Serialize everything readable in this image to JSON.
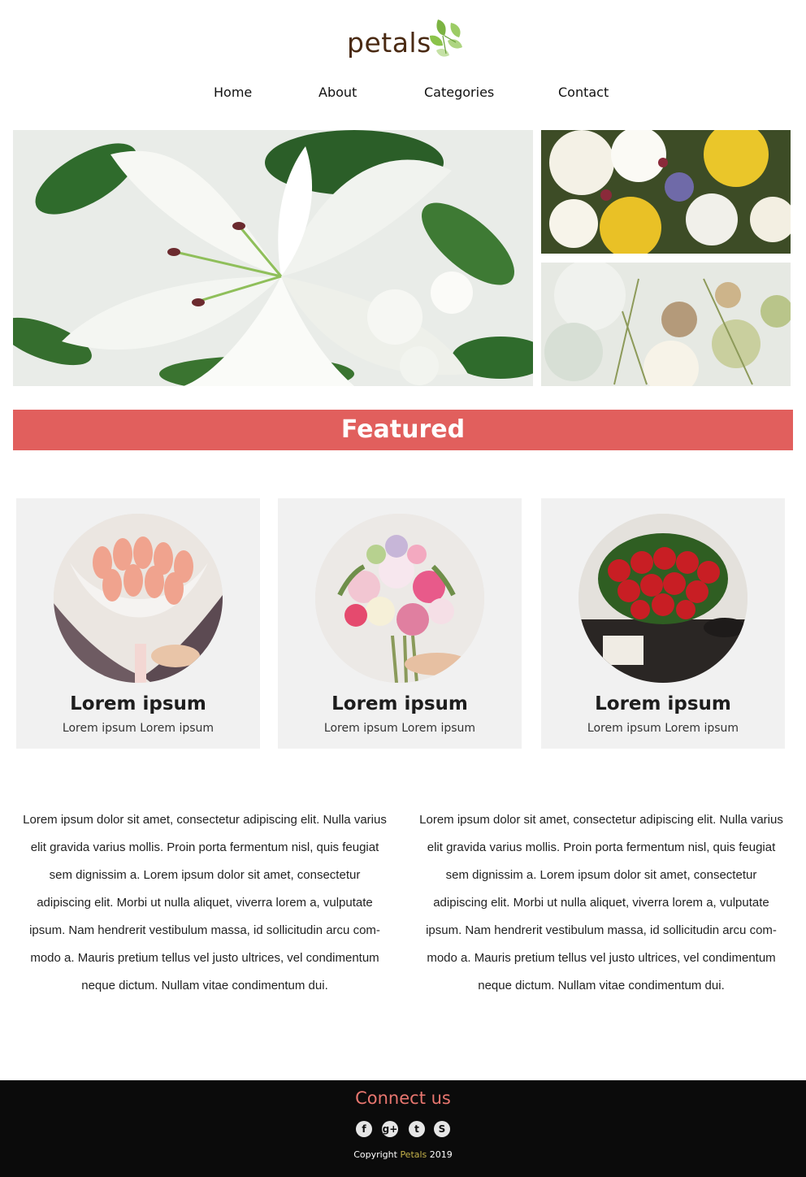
{
  "brand": {
    "logo_text": "petals"
  },
  "nav": {
    "items": [
      {
        "label": "Home"
      },
      {
        "label": "About"
      },
      {
        "label": "Categories"
      },
      {
        "label": "Contact"
      }
    ]
  },
  "featured": {
    "title": "Featured",
    "cards": [
      {
        "title": "Lorem ipsum",
        "subtitle": "Lorem ipsum Lorem ipsum"
      },
      {
        "title": "Lorem ipsum",
        "subtitle": "Lorem ipsum Lorem ipsum"
      },
      {
        "title": "Lorem ipsum",
        "subtitle": "Lorem ipsum Lorem ipsum"
      }
    ]
  },
  "content": {
    "columns": [
      {
        "text": "Lorem ipsum dolor sit amet, consectetur adipiscing elit. Nulla varius elit gravida varius mollis. Proin porta fermentum nisl, quis feugiat sem dignissim a. Lorem ipsum dolor sit amet, consectetur adipiscing elit. Morbi ut nulla aliquet, viverra lorem a, vulputate ipsum. Nam hendrerit vestibulum massa, id sollicitudin arcu com-modo a. Mauris pretium tellus vel justo ultrices, vel condimentum neque dictum. Nullam vitae condimentum dui."
      },
      {
        "text": "Lorem ipsum dolor sit amet, consectetur adipiscing elit. Nulla varius elit gravida varius mollis. Proin porta fermentum nisl, quis feugiat sem dignissim a. Lorem ipsum dolor sit amet, consectetur adipiscing elit. Morbi ut nulla aliquet, viverra lorem a, vulputate ipsum. Nam hendrerit vestibulum massa, id sollicitudin arcu com-modo a. Mauris pretium tellus vel justo ultrices, vel condimentum neque dictum. Nullam vitae condimentum dui."
      }
    ]
  },
  "footer": {
    "title": "Connect us",
    "social": [
      {
        "icon": "facebook-icon",
        "glyph": "f"
      },
      {
        "icon": "google-plus-icon",
        "glyph": "g+"
      },
      {
        "icon": "twitter-icon",
        "glyph": "t"
      },
      {
        "icon": "skype-icon",
        "glyph": "S"
      }
    ],
    "copyright_prefix": "Copyright ",
    "copyright_brand": "Petals",
    "copyright_year": " 2019"
  },
  "colors": {
    "accent": "#e15f5d",
    "footer_bg": "#0b0b0b",
    "footer_title": "#e8766f",
    "brand_gold": "#c6b34a",
    "card_bg": "#f1f1f1"
  }
}
